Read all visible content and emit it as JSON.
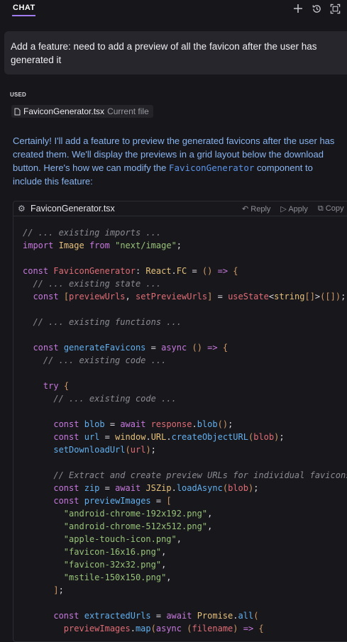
{
  "header": {
    "tab_label": "CHAT",
    "icons": [
      "plus-icon",
      "history-icon",
      "expand-icon"
    ],
    "accent_color": "#a17cf0"
  },
  "user_message": {
    "text": "Add a feature: need to add a preview of all the favicon after the user has generated it"
  },
  "context": {
    "used_label": "USED",
    "file_name": "FaviconGenerator.tsx",
    "file_note": "Current file"
  },
  "assistant": {
    "line1": "Certainly! I'll add a feature to preview the generated favicons after the user has",
    "line2": "created them. We'll display the previews in a grid layout below the download",
    "line3_pre": "button. Here's how we can modify the ",
    "line3_code": "FaviconGenerator",
    "line3_post": " component to",
    "line4": "include this feature:"
  },
  "codeblock": {
    "filename": "FaviconGenerator.tsx",
    "actions": [
      "Reply",
      "Apply",
      "Copy"
    ],
    "lines": [
      "// ... existing imports ...",
      "import Image from \"next/image\";",
      "",
      "const FaviconGenerator: React.FC = () => {",
      "  // ... existing state ...",
      "  const [previewUrls, setPreviewUrls] = useState<string[]>([]);",
      "",
      "  // ... existing functions ...",
      "",
      "  const generateFavicons = async () => {",
      "    // ... existing code ...",
      "",
      "    try {",
      "      // ... existing code ...",
      "",
      "      const blob = await response.blob();",
      "      const url = window.URL.createObjectURL(blob);",
      "      setDownloadUrl(url);",
      "",
      "      // Extract and create preview URLs for individual favicons",
      "      const zip = await JSZip.loadAsync(blob);",
      "      const previewImages = [",
      "        \"android-chrome-192x192.png\",",
      "        \"android-chrome-512x512.png\",",
      "        \"apple-touch-icon.png\",",
      "        \"favicon-16x16.png\",",
      "        \"favicon-32x32.png\",",
      "        \"mstile-150x150.png\",",
      "      ];",
      "",
      "      const extractedUrls = await Promise.all(",
      "        previewImages.map(async (filename) => {"
    ]
  }
}
